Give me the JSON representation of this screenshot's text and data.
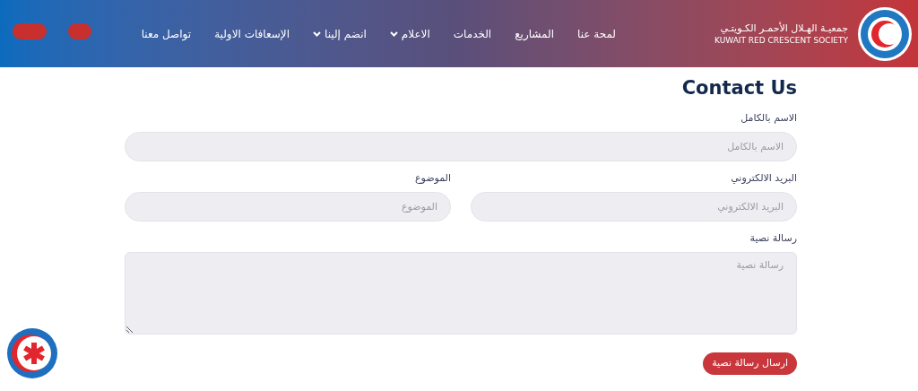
{
  "header": {
    "logo_name_ar": "جمعيـة الهـلال الأحمـر الكـويتـي",
    "logo_name_en": "KUWAIT RED CRESCENT SOCIETY",
    "nav": [
      {
        "label": "لمحة عنا",
        "dropdown": false
      },
      {
        "label": "المشاريع",
        "dropdown": false
      },
      {
        "label": "الخدمات",
        "dropdown": false
      },
      {
        "label": "الاعلام",
        "dropdown": true
      },
      {
        "label": "انضم إلينا",
        "dropdown": true
      },
      {
        "label": "الإسعافات الاولية",
        "dropdown": false
      },
      {
        "label": "تواصل معنا",
        "dropdown": false
      }
    ]
  },
  "page_title": "Contact Us",
  "form": {
    "rows": [
      [
        {
          "kind": "input",
          "label": "الاسم بالكامل",
          "placeholder": "الاسم بالكامل"
        }
      ],
      [
        {
          "kind": "input",
          "label": "البريد الالكتروني",
          "placeholder": "البريد الالكتروني"
        },
        {
          "kind": "input",
          "label": "الموضوع",
          "placeholder": "الموضوع"
        }
      ],
      [
        {
          "kind": "textarea",
          "label": "رسالة نصية",
          "placeholder": "رسالة نصية"
        }
      ]
    ],
    "submit": "ارسال رسالة نصية"
  }
}
